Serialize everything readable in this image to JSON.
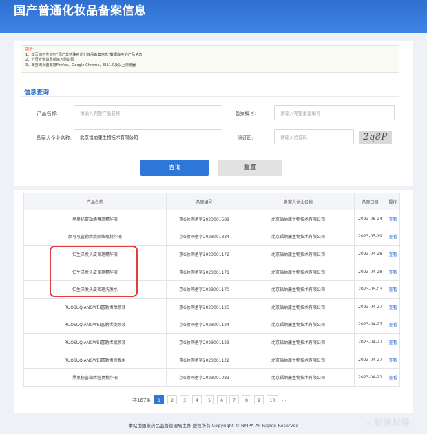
{
  "header": {
    "title": "国产普通化妆品备案信息"
  },
  "notice": {
    "title": "提示：",
    "lines": [
      "1、本页面可查询到“国产非特殊用途化妆品备案信息”数据库中的产品信息",
      "2、分页查询请重新输入验证码",
      "3、本查询页面支持Firefox、Google Chrome、IE11.0及以上浏览器"
    ]
  },
  "search": {
    "section_title": "信息查询",
    "product_name_label": "产品名称:",
    "product_name_placeholder": "请输入完整产品名称",
    "record_no_label": "备案编号:",
    "record_no_placeholder": "请输入完整备案编号",
    "company_label": "备案人企业名称:",
    "company_value": "北京福纳康生物技术有限公司",
    "captcha_label": "验证码:",
    "captcha_placeholder": "请输入验证码",
    "captcha_image_text": "2q8P",
    "query_button": "查询",
    "reset_button": "重置"
  },
  "table": {
    "columns": [
      "产品名称",
      "备案编号",
      "备案人企业名称",
      "备案日期",
      "操作"
    ],
    "rows": [
      [
        "黑奥秘富勒烯菁萃精华液",
        "京G妆网备字2023001589",
        "北京福纳康生物技术有限公司",
        "2023-05-24",
        "查看"
      ],
      [
        "颜可攻富勒烯焕颜炫瓶精华液",
        "京G妆网备字2023001334",
        "北京福纳康生物技术有限公司",
        "2023-05-19",
        "查看"
      ],
      [
        "仁生泽发头皮调理精华液",
        "京G妆网备字2023001172",
        "北京福纳康生物技术有限公司",
        "2023-04-28",
        "查看"
      ],
      [
        "仁生泽发头皮调理精华液",
        "京G妆网备字2023001171",
        "北京福纳康生物技术有限公司",
        "2023-04-28",
        "查看"
      ],
      [
        "仁生泽发头皮调理洗发水",
        "京G妆网备字2023001170",
        "北京福纳康生物技术有限公司",
        "2023-05-03",
        "查看"
      ],
      [
        "RUOSUQIANGWEI富勒烯臻颜液",
        "京G妆网备字2023001125",
        "北京福纳康生物技术有限公司",
        "2023-04-27",
        "查看"
      ],
      [
        "RUOSUQIANGWEI富勒烯焕颜液",
        "京G妆网备字2023001124",
        "北京福纳康生物技术有限公司",
        "2023-04-27",
        "查看"
      ],
      [
        "RUOSUQIANGWEI富勒烯润颜液",
        "京G妆网备字2023001123",
        "北京福纳康生物技术有限公司",
        "2023-04-27",
        "查看"
      ],
      [
        "RUOSUQIANGWEI富勒烯漂靓水",
        "京G妆网备字2023001122",
        "北京福纳康生物技术有限公司",
        "2023-04-27",
        "查看"
      ],
      [
        "黑奥秘富勒烯莹亮精华液",
        "京G妆网备字2023001083",
        "北京福纳康生物技术有限公司",
        "2023-04-21",
        "查看"
      ]
    ]
  },
  "pagination": {
    "total": "共167条",
    "pages": [
      "1",
      "2",
      "3",
      "4",
      "5",
      "6",
      "7",
      "8",
      "9",
      "10"
    ],
    "active": "1",
    "ellipsis": "..."
  },
  "footer": {
    "text": "本站由国家药品监督管理局主办 版权所有 Copyright © NMPA All Rights Reserved"
  },
  "watermark": {
    "text": "新浪财经"
  },
  "colors": {
    "header": "#2f6fd0",
    "accent": "#2e77d9",
    "highlight": "#e03e3e",
    "link": "#2a6bc7"
  }
}
